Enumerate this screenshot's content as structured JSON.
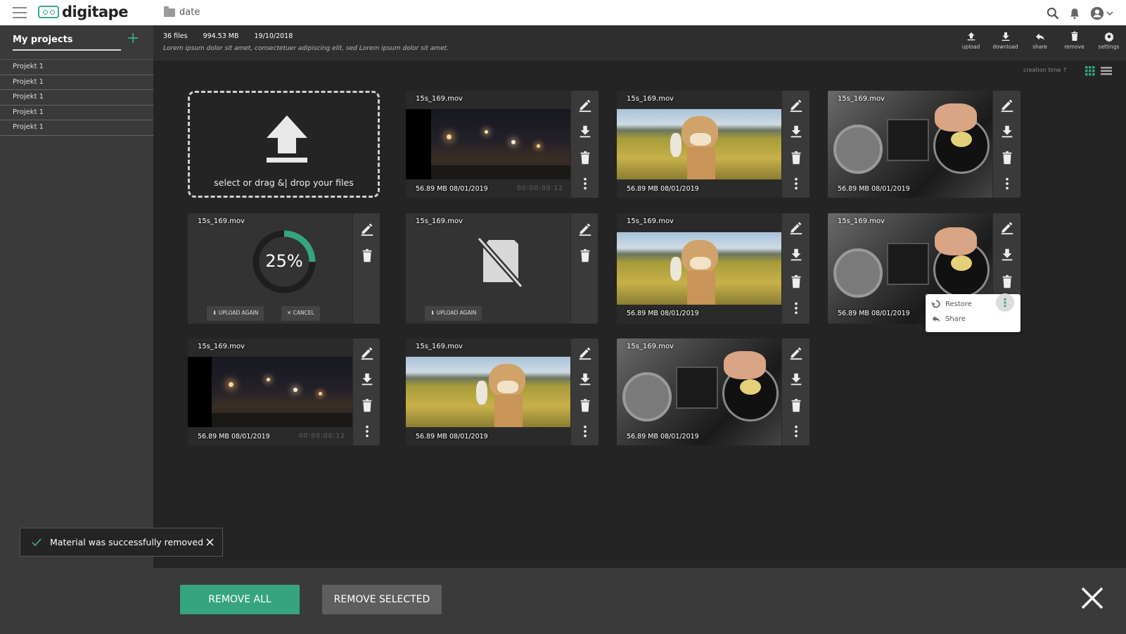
{
  "app": {
    "name": "digitape",
    "breadcrumb": "date"
  },
  "colors": {
    "accent": "#36a47f",
    "sidebar": "#3a3a3a",
    "background": "#242424"
  },
  "topbar_icons": [
    "menu-icon",
    "search-icon",
    "bell-icon",
    "account-icon",
    "chevron-down-icon"
  ],
  "sidebar": {
    "title": "My projects",
    "add_icon": "plus-icon",
    "items": [
      {
        "label": "Projekt 1"
      },
      {
        "label": "Projekt 1"
      },
      {
        "label": "Projekt 1"
      },
      {
        "label": "Projekt 1"
      },
      {
        "label": "Projekt 1"
      }
    ]
  },
  "info": {
    "files": "36 files",
    "size": "994.53 MB",
    "date": "19/10/2018",
    "description": "Lorem ipsum dolor sit amet, consectetuer adipiscing elit, sed Lorem ipsum dolor sit amet."
  },
  "actions": [
    {
      "label": "upload",
      "icon": "upload-icon"
    },
    {
      "label": "download",
      "icon": "download-icon"
    },
    {
      "label": "share",
      "icon": "share-icon"
    },
    {
      "label": "remove",
      "icon": "trash-icon"
    },
    {
      "label": "settings",
      "icon": "gear-icon"
    }
  ],
  "sort": {
    "label": "creation time ↑"
  },
  "upload_zone": {
    "text": "select or drag &| drop your files"
  },
  "files": {
    "night": {
      "name": "15s_169.mov",
      "meta": "56.89 MB  08/01/2019",
      "timecode": "00:00:00:12"
    },
    "alpaca": {
      "name": "15s_169.mov",
      "meta": "56.89 MB  08/01/2019"
    },
    "dj": {
      "name": "15s_169.mov",
      "meta": "56.89 MB  08/01/2019"
    },
    "uploading": {
      "name": "15s_169.mov",
      "progress_percent": 25,
      "progress_label": "25%",
      "upload_again": "UPLOAD AGAIN",
      "cancel": "CANCEL"
    },
    "failed": {
      "name": "15s_169.mov",
      "upload_again": "UPLOAD AGAIN"
    }
  },
  "popup": {
    "restore": "Restore",
    "share": "Share"
  },
  "toast": {
    "message": "Material was successfully removed"
  },
  "footer": {
    "remove_all": "REMOVE ALL",
    "remove_selected": "REMOVE SELECTED"
  }
}
